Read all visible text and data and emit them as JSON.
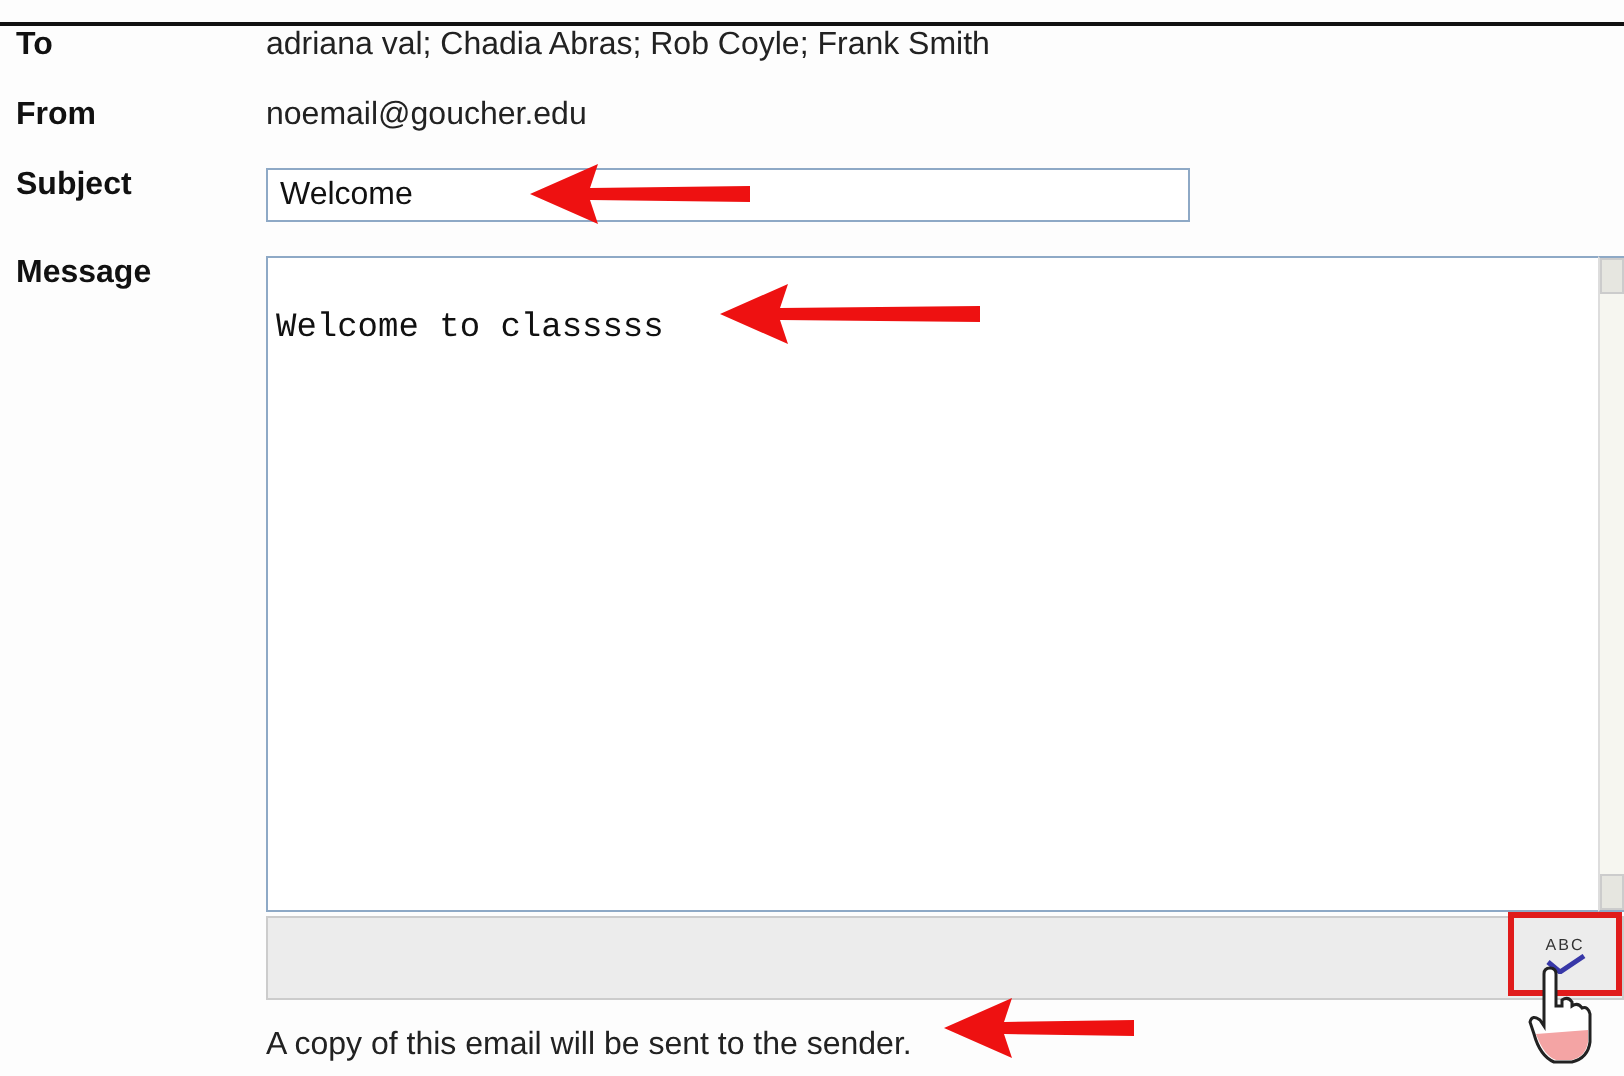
{
  "fields": [
    {
      "kind": "text",
      "label": "To",
      "value": "adriana val; Chadia Abras; Rob Coyle; Frank Smith"
    },
    {
      "kind": "text",
      "label": "From",
      "value": "noemail@goucher.edu"
    },
    {
      "kind": "input",
      "label": "Subject",
      "value": "Welcome"
    },
    {
      "kind": "textarea",
      "label": "Message",
      "value": "Welcome to classsss"
    }
  ],
  "spellcheck": {
    "label": "ABC",
    "highlighted": true
  },
  "note": "A copy of this email will be sent to the sender."
}
